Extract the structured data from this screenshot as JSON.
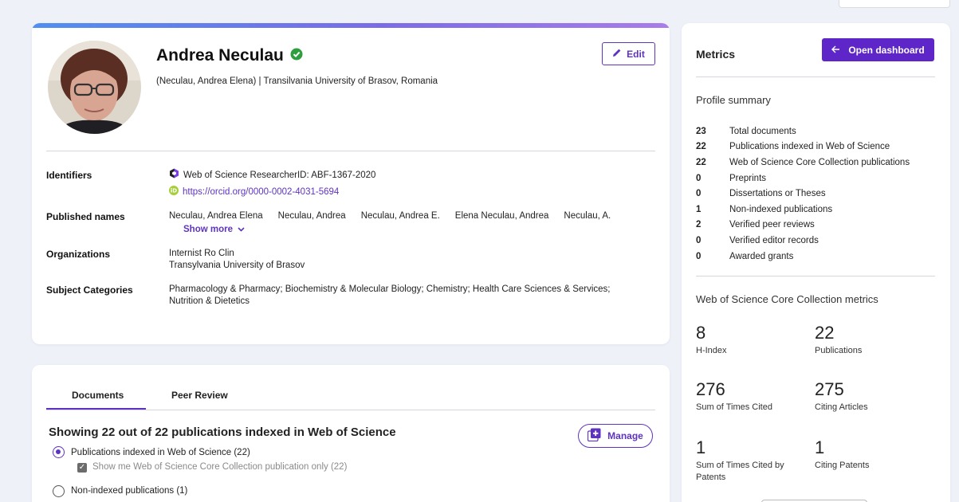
{
  "profile": {
    "name": "Andrea Neculau",
    "subline": "(Neculau, Andrea Elena) | Transilvania University of Brasov, Romania",
    "edit_label": "Edit",
    "identifiers_label": "Identifiers",
    "researcher_id": "Web of Science ResearcherID: ABF-1367-2020",
    "orcid": "https://orcid.org/0000-0002-4031-5694",
    "published_names_label": "Published names",
    "published_names": [
      "Neculau, Andrea Elena",
      "Neculau, Andrea",
      "Neculau, Andrea E.",
      "Elena Neculau, Andrea",
      "Neculau, A."
    ],
    "show_more": "Show more",
    "organizations_label": "Organizations",
    "organizations": [
      "Internist Ro Clin",
      "Transylvania University of Brasov"
    ],
    "subject_categories_label": "Subject Categories",
    "subject_categories_line1": "Pharmacology & Pharmacy;  Biochemistry & Molecular Biology;  Chemistry;  Health Care Sciences & Services;",
    "subject_categories_line2": "Nutrition & Dietetics"
  },
  "documents": {
    "tabs": [
      "Documents",
      "Peer Review"
    ],
    "showing": "Showing 22 out of 22 publications indexed in Web of Science",
    "manage_label": "Manage",
    "option_indexed": "Publications indexed in Web of Science (22)",
    "option_core_only": "Show me Web of Science Core Collection publication only (22)",
    "option_non_indexed": "Non-indexed publications (1)"
  },
  "metrics": {
    "title": "Metrics",
    "dashboard_label": "Open dashboard",
    "profile_summary_title": "Profile summary",
    "summary": [
      {
        "count": "23",
        "label": "Total documents"
      },
      {
        "count": "22",
        "label": "Publications indexed in Web of Science"
      },
      {
        "count": "22",
        "label": "Web of Science Core Collection publications"
      },
      {
        "count": "0",
        "label": "Preprints"
      },
      {
        "count": "0",
        "label": "Dissertations or Theses"
      },
      {
        "count": "1",
        "label": "Non-indexed publications"
      },
      {
        "count": "2",
        "label": "Verified peer reviews"
      },
      {
        "count": "0",
        "label": "Verified editor records"
      },
      {
        "count": "0",
        "label": "Awarded grants"
      }
    ],
    "core_title": "Web of Science Core Collection metrics",
    "core": [
      {
        "value": "8",
        "label": "H-Index"
      },
      {
        "value": "22",
        "label": "Publications"
      },
      {
        "value": "276",
        "label": "Sum of Times Cited"
      },
      {
        "value": "275",
        "label": "Citing Articles"
      },
      {
        "value": "1",
        "label": "Sum of Times Cited by Patents"
      },
      {
        "value": "1",
        "label": "Citing Patents"
      }
    ]
  },
  "colors": {
    "accent": "#5e33bf",
    "verified": "#2e9e3e",
    "orcid": "#a6ce39"
  }
}
